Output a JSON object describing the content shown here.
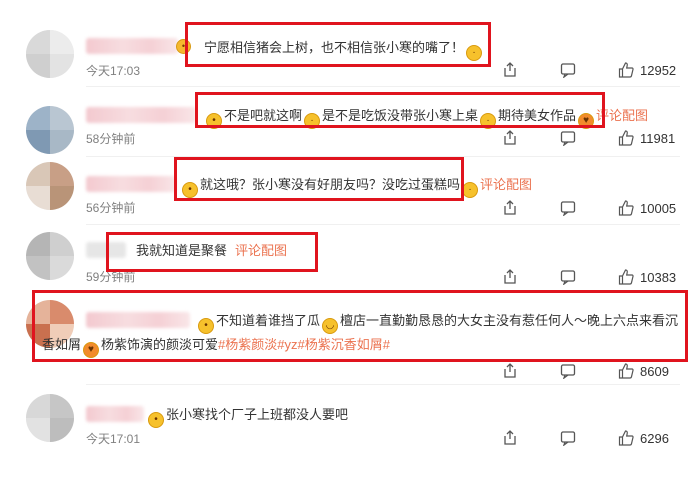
{
  "colors": {
    "highlight_box": "#e0141e",
    "link": "#eb7350",
    "muted": "#808080"
  },
  "comments": [
    {
      "text": "宁愿相信猪会上树，也不相信张小寒的嘴了！",
      "time": "今天17:03",
      "likes": "12952",
      "emoji_after": "crying-face"
    },
    {
      "text_parts": [
        "不是吧就这啊",
        "是不是吃饭没带张小寒上桌",
        "期待美女作品"
      ],
      "pic_link": "评论配图",
      "time": "58分钟前",
      "likes": "11981"
    },
    {
      "text": "就这哦？张小寒没有好朋友吗？没吃过蛋糕吗",
      "pic_link": "评论配图",
      "time": "56分钟前",
      "likes": "10005"
    },
    {
      "text": "我就知道是聚餐",
      "pic_link": "评论配图",
      "time": "59分钟前",
      "likes": "10383"
    },
    {
      "line1_parts": [
        "不知道着谁挡了瓜",
        "檀店一直勤勤恳恳的大女主没有惹任何人～晚上六点来看沉"
      ],
      "line2_plain": "香如屑",
      "line2_text": "杨紫饰演的颜淡可爱",
      "hashtags": [
        "#杨紫颜淡#",
        "yz",
        "#杨紫沉香如屑#"
      ],
      "likes": "8609"
    },
    {
      "text": "张小寒找个厂子上班都没人要吧",
      "time": "今天17:01",
      "likes": "6296"
    }
  ]
}
